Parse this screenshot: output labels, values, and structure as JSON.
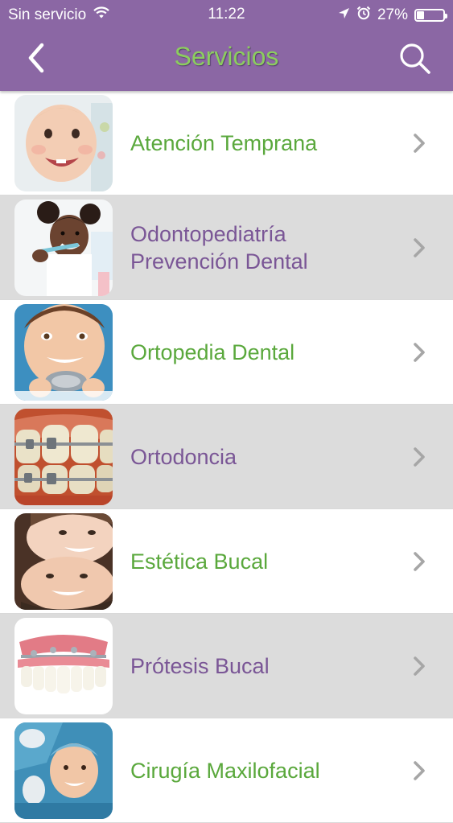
{
  "status_bar": {
    "carrier": "Sin servicio",
    "time": "11:22",
    "battery_percent": "27%",
    "battery_level": 0.27,
    "icons": [
      "wifi-icon",
      "location-arrow-icon",
      "alarm-icon",
      "battery-icon"
    ]
  },
  "nav": {
    "title": "Servicios",
    "back_icon": "chevron-left-icon",
    "search_icon": "search-icon"
  },
  "colors": {
    "bar": "#8b67a4",
    "title": "#8ccd5f",
    "green_text": "#5aa83c",
    "purple_text": "#7a5696",
    "row_gray": "#dcdcdc",
    "chevron": "#a6a6a6"
  },
  "services": [
    {
      "lines": [
        "Atención Temprana"
      ],
      "image": "baby-photo",
      "color": "green"
    },
    {
      "lines": [
        "Odontopediatría",
        "Prevención Dental"
      ],
      "image": "girl-brushing-teeth-photo",
      "color": "purple"
    },
    {
      "lines": [
        "Ortopedia Dental"
      ],
      "image": "boy-with-retainer-photo",
      "color": "green"
    },
    {
      "lines": [
        "Ortodoncia"
      ],
      "image": "teeth-braces-photo",
      "color": "purple"
    },
    {
      "lines": [
        "Estética Bucal"
      ],
      "image": "smiling-couple-photo",
      "color": "green"
    },
    {
      "lines": [
        "Prótesis Bucal"
      ],
      "image": "dental-prosthesis-photo",
      "color": "purple"
    },
    {
      "lines": [
        "Cirugía Maxilofacial"
      ],
      "image": "surgery-patient-photo",
      "color": "green"
    }
  ]
}
